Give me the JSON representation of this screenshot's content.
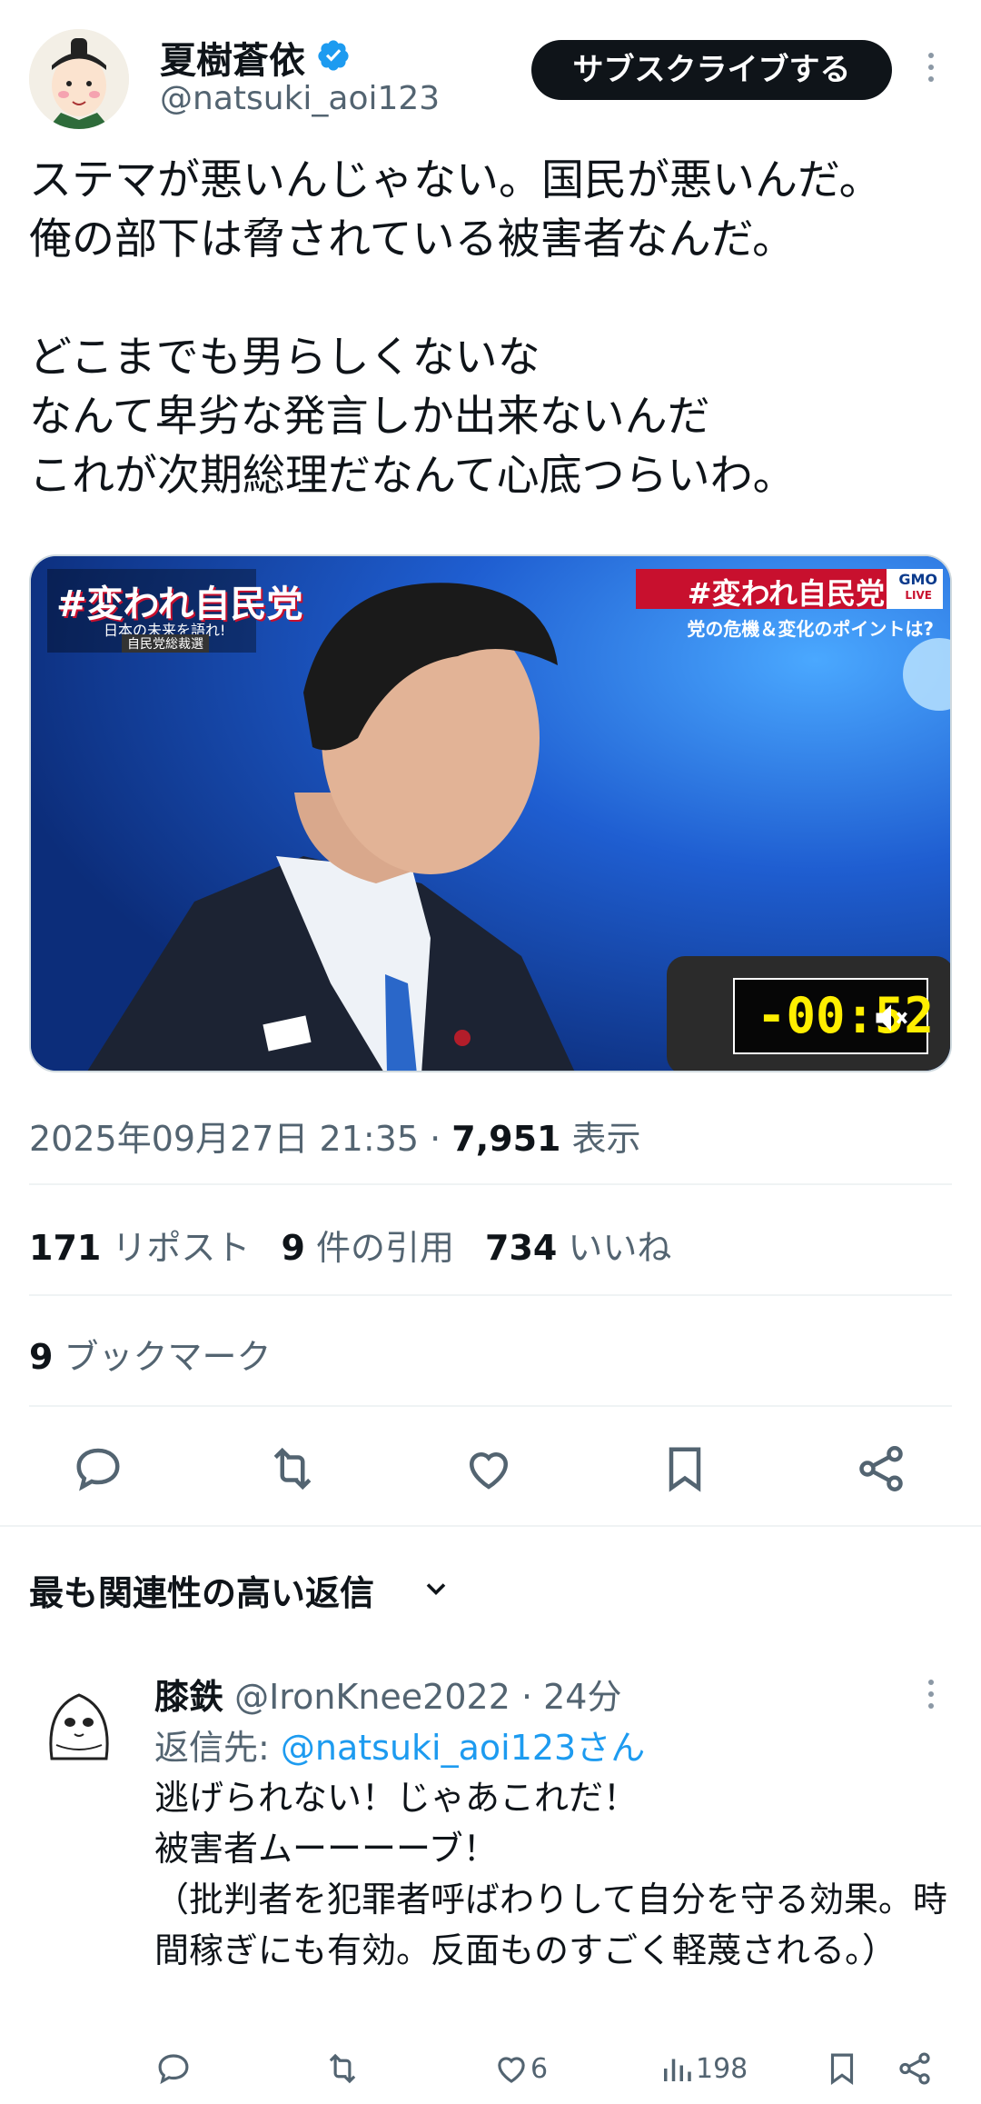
{
  "header": {
    "name": "夏樹蒼依",
    "handle": "@natsuki_aoi123",
    "subscribe_label": "サブスクライブする"
  },
  "tweet": {
    "text": "ステマが悪いんじゃない。国民が悪いんだ。\n俺の部下は脅されている被害者なんだ。\n\nどこまでも男らしくないな\nなんて卑劣な発言しか出来ないんだ\nこれが次期総理だなんて心底つらいわ。"
  },
  "media": {
    "overlay_left": "#変われ自民党",
    "overlay_left_sub": "日本の未来を語れ!",
    "overlay_left_sub2": "自民党総裁選",
    "overlay_right_title": "#変われ自民党",
    "overlay_right_sub": "党の危機＆変化のポイントは?",
    "brand": "GMO",
    "brand_sub": "LIVE",
    "timer": "-00:52",
    "accent_color": "#c8102e"
  },
  "meta": {
    "datetime": "2025年09月27日 21:35 · ",
    "views_count": "7,951",
    "views_label": " 表示"
  },
  "stats": {
    "reposts_count": "171",
    "reposts_label": "リポスト",
    "quotes_count": "9",
    "quotes_label": "件の引用",
    "likes_count": "734",
    "likes_label": "いいね",
    "bookmarks_count": "9",
    "bookmarks_label": "ブックマーク"
  },
  "relevant_label": "最も関連性の高い返信",
  "reply": {
    "name": "膝鉄",
    "handle_time": " @IronKnee2022 · 24分",
    "reply_to_prefix": "返信先: ",
    "reply_to_handle": "@natsuki_aoi123さん",
    "text": "逃げられない！じゃあこれだ！\n被害者ムーーーーブ！\n（批判者を犯罪者呼ばわりして自分を守る効果。時間稼ぎにも有効。反面ものすごく軽蔑される。）",
    "likes": "6",
    "views": "198"
  }
}
